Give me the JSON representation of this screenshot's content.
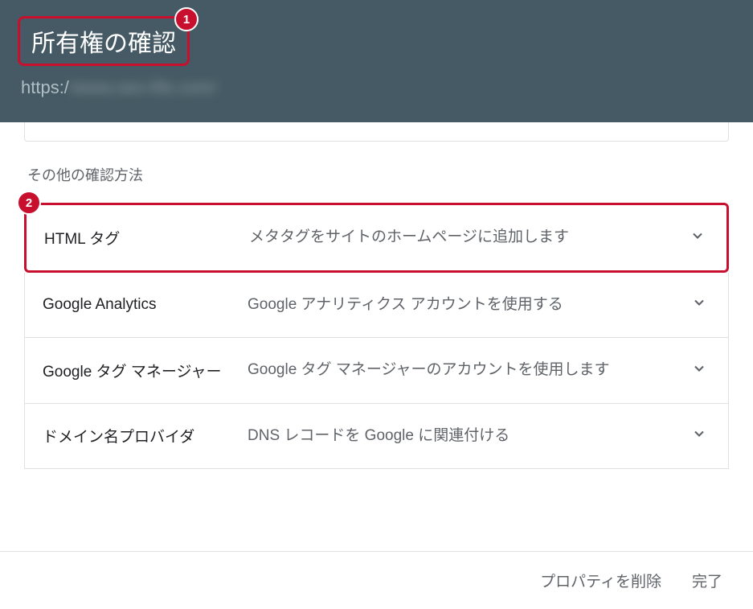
{
  "header": {
    "title": "所有権の確認",
    "url_prefix": "https:/",
    "url_blurred": "/www.seo-life.com/"
  },
  "badges": {
    "one": "1",
    "two": "2"
  },
  "section_label": "その他の確認方法",
  "options": [
    {
      "title": "HTML タグ",
      "desc": "メタタグをサイトのホームページに追加します",
      "highlighted": true
    },
    {
      "title": "Google Analytics",
      "desc": "Google アナリティクス アカウントを使用する",
      "highlighted": false
    },
    {
      "title": "Google タグ マネージャー",
      "desc": "Google タグ マネージャーのアカウントを使用します",
      "highlighted": false
    },
    {
      "title": "ドメイン名プロバイダ",
      "desc": "DNS レコードを Google に関連付ける",
      "highlighted": false
    }
  ],
  "footer": {
    "delete": "プロパティを削除",
    "done": "完了"
  }
}
